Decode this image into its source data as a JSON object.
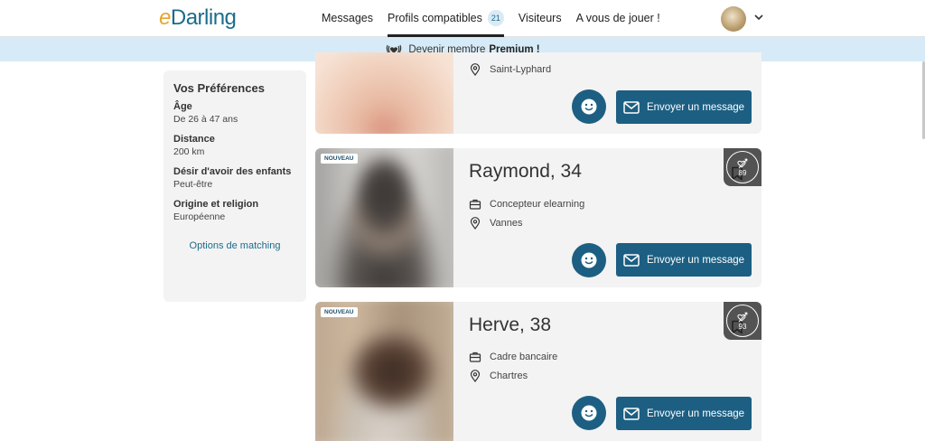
{
  "header": {
    "logo_prefix": "e",
    "logo_text": "Darling",
    "nav": [
      {
        "label": "Messages"
      },
      {
        "label": "Profils compatibles",
        "badge": "21"
      },
      {
        "label": "Visiteurs"
      },
      {
        "label": "A vous de jouer !"
      }
    ]
  },
  "banner": {
    "text": "Devenir membre",
    "emphasis": "Premium !"
  },
  "sidebar": {
    "title": "Vos Préférences",
    "items": [
      {
        "label": "Âge",
        "value": "De 26 à 47 ans"
      },
      {
        "label": "Distance",
        "value": "200 km"
      },
      {
        "label": "Désir d'avoir des enfants",
        "value": "Peut-être"
      },
      {
        "label": "Origine et religion",
        "value": "Européenne"
      }
    ],
    "link": "Options de matching"
  },
  "cards": [
    {
      "location": "Saint-Lyphard",
      "message_label": "Envoyer un message"
    },
    {
      "tag": "NOUVEAU",
      "score": "89",
      "name": "Raymond, 34",
      "job": "Concepteur elearning",
      "location": "Vannes",
      "message_label": "Envoyer un message"
    },
    {
      "tag": "NOUVEAU",
      "score": "93",
      "name": "Herve, 38",
      "job": "Cadre bancaire",
      "location": "Chartres",
      "message_label": "Envoyer un message"
    }
  ],
  "colors": {
    "brand": "#1c6c8c",
    "button": "#1c5f82",
    "banner_bg": "#d6ebf7",
    "logo_accent": "#e3a72f"
  }
}
